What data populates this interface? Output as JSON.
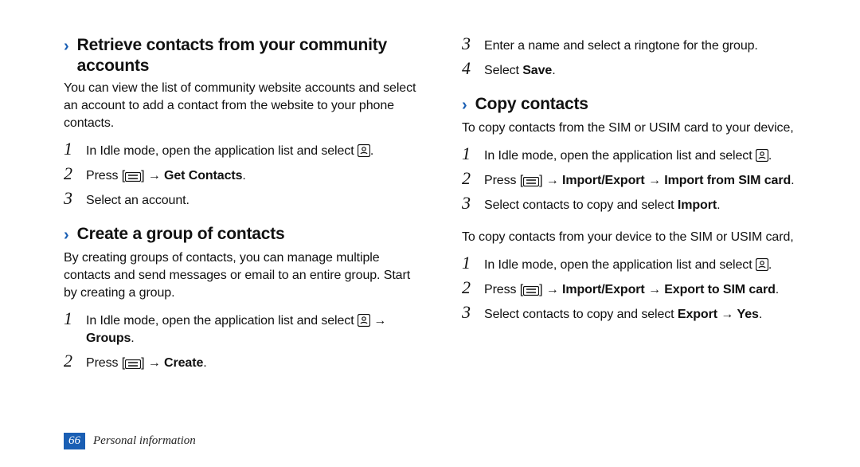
{
  "page_number": "66",
  "footer_title": "Personal information",
  "left": {
    "sec1": {
      "title": "Retrieve contacts from your community accounts",
      "intro": "You can view the list of community website accounts and select an account to add a contact from the website to your phone contacts.",
      "steps": {
        "s1a": "In Idle mode, open the application list and select ",
        "s1b": ".",
        "s2a": "Press [",
        "s2b": "] → ",
        "s2c": "Get Contacts",
        "s2d": ".",
        "s3": "Select an account."
      }
    },
    "sec2": {
      "title": "Create a group of contacts",
      "intro": "By creating groups of contacts, you can manage multiple contacts and send messages or email to an entire group. Start by creating a group.",
      "steps": {
        "s1a": "In Idle mode, open the application list and select ",
        "s1b": " → ",
        "s1c": "Groups",
        "s1d": ".",
        "s2a": "Press [",
        "s2b": "] → ",
        "s2c": "Create",
        "s2d": "."
      }
    }
  },
  "right": {
    "cont_steps": {
      "s3": "Enter a name and select a ringtone for the group.",
      "s4a": "Select ",
      "s4b": "Save",
      "s4c": "."
    },
    "sec3": {
      "title": "Copy contacts",
      "intro1": "To copy contacts from the SIM or USIM card to your device,",
      "stepsA": {
        "s1a": "In Idle mode, open the application list and select ",
        "s1b": ".",
        "s2a": "Press [",
        "s2b": "] → ",
        "s2c": "Import/Export",
        "s2d": " → ",
        "s2e": "Import from SIM card",
        "s2f": ".",
        "s3a": "Select contacts to copy and select ",
        "s3b": "Import",
        "s3c": "."
      },
      "intro2": "To copy contacts from your device to the SIM or USIM card,",
      "stepsB": {
        "s1a": "In Idle mode, open the application list and select ",
        "s1b": ".",
        "s2a": "Press [",
        "s2b": "] → ",
        "s2c": "Import/Export",
        "s2d": " → ",
        "s2e": "Export to SIM card",
        "s2f": ".",
        "s3a": "Select contacts to copy and select ",
        "s3b": "Export",
        "s3c": " → ",
        "s3d": "Yes",
        "s3e": "."
      }
    }
  }
}
